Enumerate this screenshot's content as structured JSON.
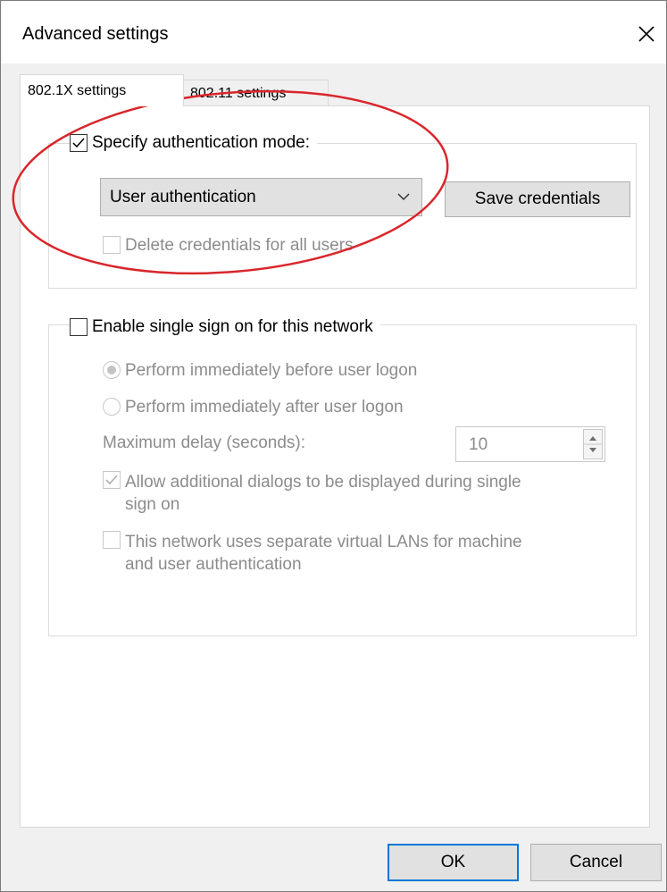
{
  "window": {
    "title": "Advanced settings",
    "close_icon": "close-icon"
  },
  "tabs": [
    {
      "label": "802.1X settings",
      "active": true
    },
    {
      "label": "802.11 settings",
      "active": false
    }
  ],
  "auth_group": {
    "checkbox_label": "Specify authentication mode:",
    "checked": true,
    "mode_value": "User authentication",
    "save_credentials_label": "Save credentials",
    "delete_credentials_label": "Delete credentials for all users"
  },
  "sso_group": {
    "checkbox_label": "Enable single sign on for this network",
    "checked": false,
    "radio_before_label": "Perform immediately before user logon",
    "radio_after_label": "Perform immediately after user logon",
    "delay_label": "Maximum delay (seconds):",
    "delay_value": "10",
    "allow_dialogs_label_line1": "Allow additional dialogs to be displayed during single",
    "allow_dialogs_label_line2": "sign on",
    "separate_vlans_label_line1": "This network uses separate virtual LANs for machine",
    "separate_vlans_label_line2": "and user authentication"
  },
  "footer": {
    "ok_label": "OK",
    "cancel_label": "Cancel"
  },
  "colors": {
    "annotation": "#d9262b",
    "accent": "#0078d7",
    "disabled_text": "#8c8c8c"
  }
}
